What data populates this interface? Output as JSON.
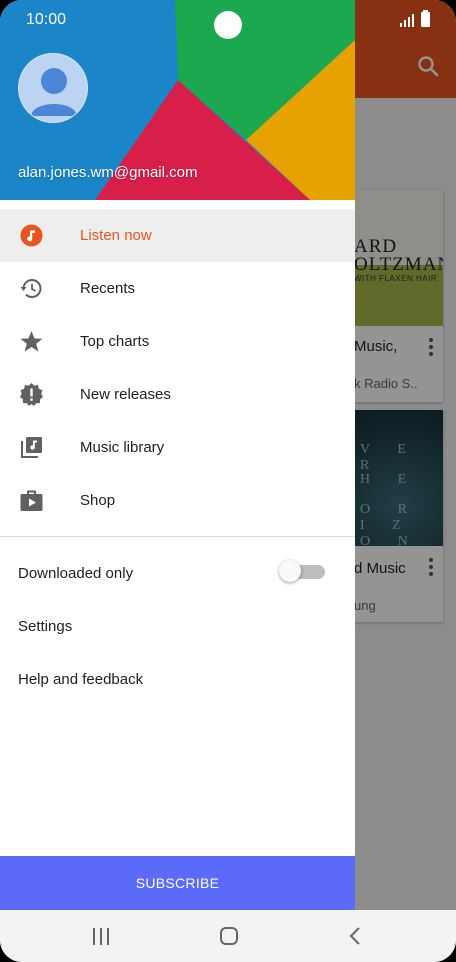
{
  "status_bar": {
    "time": "10:00"
  },
  "account": {
    "email": "alan.jones.wm@gmail.com"
  },
  "nav": {
    "items": [
      {
        "label": "Listen now",
        "icon": "music-note-icon",
        "active": true
      },
      {
        "label": "Recents",
        "icon": "history-icon"
      },
      {
        "label": "Top charts",
        "icon": "star-icon"
      },
      {
        "label": "New releases",
        "icon": "new-releases-icon"
      },
      {
        "label": "Music library",
        "icon": "library-music-icon"
      },
      {
        "label": "Shop",
        "icon": "shop-icon"
      }
    ]
  },
  "settings": {
    "downloaded_only": {
      "label": "Downloaded only",
      "enabled": false
    },
    "settings_label": "Settings",
    "help_label": "Help and feedback"
  },
  "subscribe_label": "SUBSCRIBE",
  "background": {
    "cards": [
      {
        "album_top": "RICHARD STOLTZMAN",
        "album_line1": "ARD",
        "album_line2": "OLTZMAN",
        "album_line3": "WITH FLAXEN HAIR",
        "title": "Music,",
        "subtitle": "k Radio S.."
      },
      {
        "album_words": [
          "V E R",
          "H E",
          "O R I Z O N"
        ],
        "title": "d Music",
        "subtitle": "ung"
      }
    ]
  },
  "colors": {
    "accent": "#e8541f",
    "subscribe": "#5c6afa",
    "header_blue": "#1a86c8",
    "header_green": "#1ba84f",
    "header_red": "#d71f4a",
    "header_yellow": "#e8a200"
  }
}
